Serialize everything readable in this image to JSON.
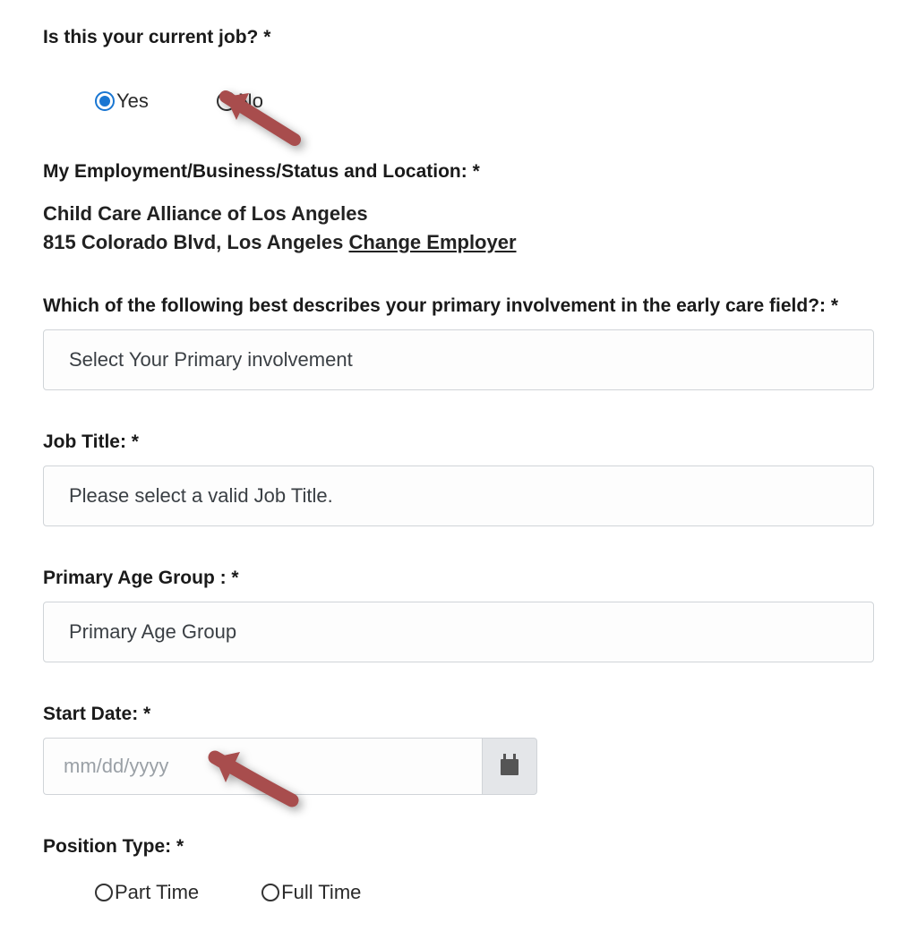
{
  "q_current_job": {
    "label": "Is this your current job? *",
    "options": {
      "yes": "Yes",
      "no": "No"
    },
    "selected": "yes"
  },
  "employment_status": {
    "label": "My Employment/Business/Status and Location: *",
    "employer_name": "Child Care Alliance of Los Angeles",
    "employer_address": "815 Colorado Blvd, Los Angeles ",
    "change_link": "Change Employer"
  },
  "primary_involvement": {
    "label": "Which of the following best describes your primary involvement in the early care field?: *",
    "placeholder": "Select Your Primary involvement"
  },
  "job_title": {
    "label": "Job Title: *",
    "placeholder": "Please select a valid Job Title."
  },
  "primary_age_group": {
    "label": "Primary Age Group : *",
    "placeholder": "Primary Age Group"
  },
  "start_date": {
    "label": "Start Date: *",
    "placeholder": "mm/dd/yyyy"
  },
  "position_type": {
    "label": "Position Type: *",
    "options": {
      "part": "Part Time",
      "full": "Full Time"
    }
  },
  "annotation_arrows": {
    "count": 2,
    "color": "#a84d4d"
  }
}
